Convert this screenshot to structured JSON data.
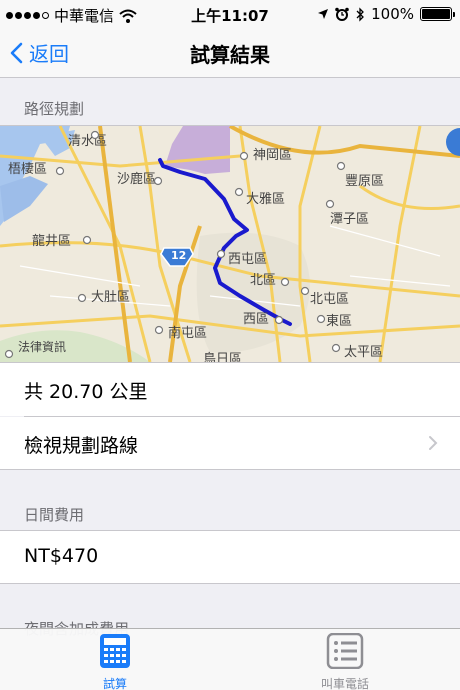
{
  "status_bar": {
    "carrier": "中華電信",
    "time": "上午11:07",
    "battery": "100%"
  },
  "nav": {
    "back_label": "返回",
    "title": "試算結果"
  },
  "route_section": {
    "header": "路徑規劃",
    "map": {
      "highway_shield": "12",
      "labels": [
        "清水區",
        "神岡區",
        "梧棲區",
        "沙鹿區",
        "豐原區",
        "大雅區",
        "潭子區",
        "龍井區",
        "西屯區",
        "北區",
        "北屯區",
        "大肚區",
        "西區",
        "東區",
        "南屯區",
        "太平區",
        "鳥日區",
        "法律資訊"
      ]
    },
    "distance": "共 20.70 公里",
    "view_route": "檢視規劃路線"
  },
  "day_fee_section": {
    "header": "日間費用",
    "value": "NT$470"
  },
  "night_fee_section": {
    "header": "夜間含加成費用"
  },
  "tabs": [
    {
      "label": "試算",
      "icon": "calculator-icon",
      "active": true
    },
    {
      "label": "叫車電話",
      "icon": "list-icon",
      "active": false
    }
  ],
  "colors": {
    "accent": "#1a7cf9",
    "route": "#1a1acd",
    "inactive_tab": "#8e8e93"
  }
}
